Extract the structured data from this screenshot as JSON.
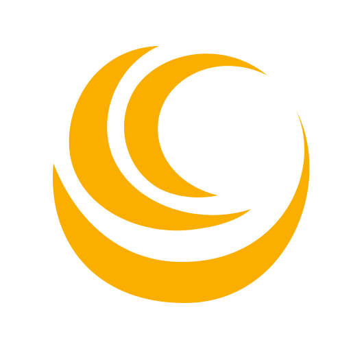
{
  "logo": {
    "icon": "crescent-swirl-logo-icon",
    "color": "#F9AE00",
    "background": "#FFFFFF"
  }
}
